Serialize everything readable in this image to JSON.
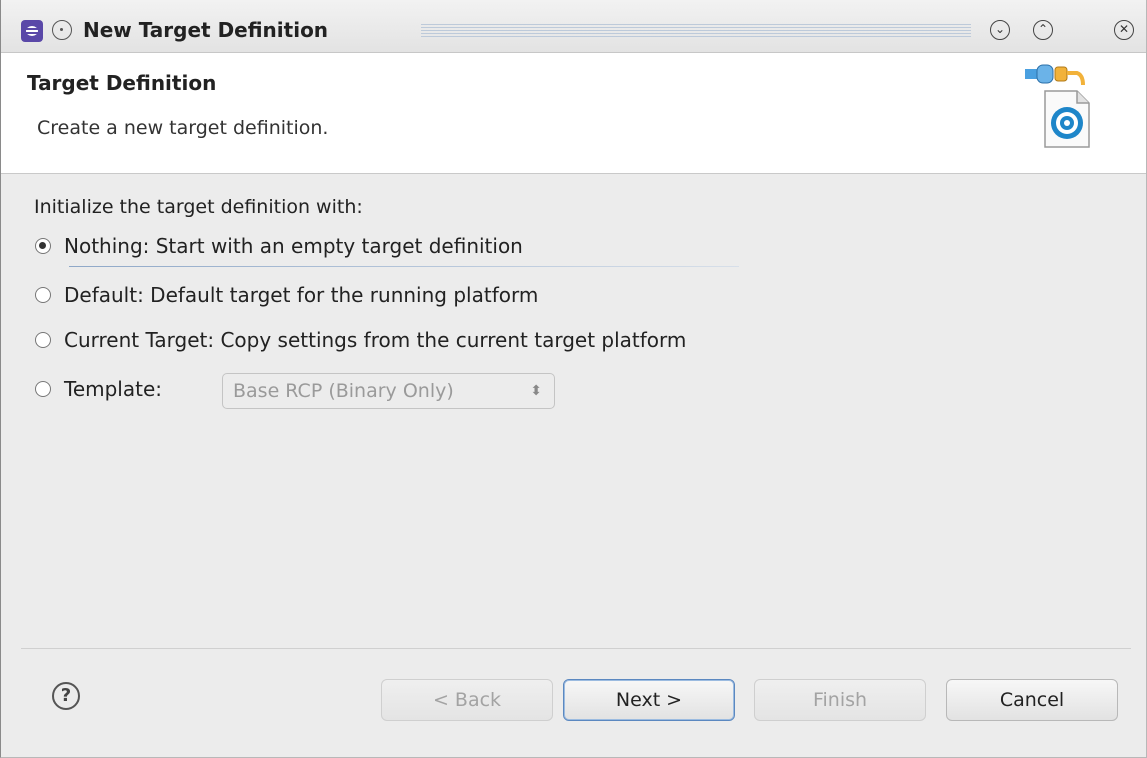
{
  "window": {
    "title": "New Target Definition"
  },
  "banner": {
    "title": "Target Definition",
    "description": "Create a new target definition."
  },
  "form": {
    "prompt": "Initialize the target definition with:",
    "options": [
      {
        "label": "Nothing: Start with an empty target definition",
        "checked": true
      },
      {
        "label": "Default: Default target for the running platform",
        "checked": false
      },
      {
        "label": "Current Target: Copy settings from the current target platform",
        "checked": false
      },
      {
        "label": "Template:",
        "checked": false
      }
    ],
    "template_combo": {
      "value": "Base RCP (Binary Only)",
      "enabled": false
    }
  },
  "buttons": {
    "back": "< Back",
    "next": "Next >",
    "finish": "Finish",
    "cancel": "Cancel"
  },
  "icons": {
    "app": "eclipse-icon",
    "sticky": "sticky-icon",
    "minimize": "minimize-icon",
    "maximize": "maximize-icon",
    "close": "close-icon",
    "wizard": "target-definition-wizard-icon",
    "help": "help-icon"
  },
  "colors": {
    "accent": "#5a48a8",
    "focus": "#5b88c0"
  }
}
